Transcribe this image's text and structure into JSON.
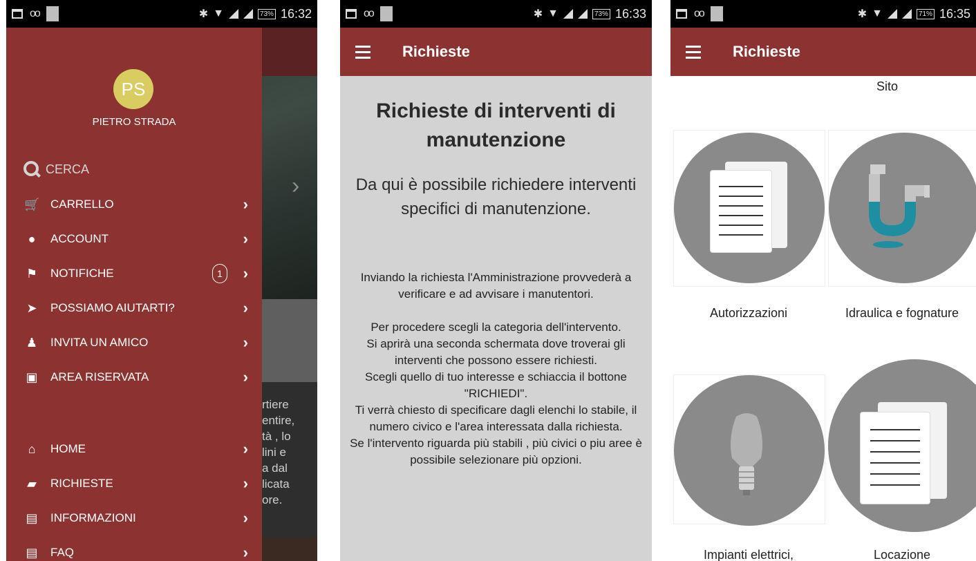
{
  "status_bars": [
    {
      "battery": "73%",
      "time": "16:32"
    },
    {
      "battery": "73%",
      "time": "16:33"
    },
    {
      "battery": "71%",
      "time": "16:35"
    }
  ],
  "drawer": {
    "avatar_initials": "PS",
    "user_name": "PIETRO STRADA",
    "search_label": "CERCA",
    "items": [
      {
        "label": "CARRELLO",
        "icon": "cart-icon"
      },
      {
        "label": "ACCOUNT",
        "icon": "person-icon"
      },
      {
        "label": "NOTIFICHE",
        "icon": "flag-icon",
        "badge": "1"
      },
      {
        "label": "POSSIAMO AIUTARTI?",
        "icon": "paper-plane-icon"
      },
      {
        "label": "INVITA UN AMICO",
        "icon": "people-icon"
      },
      {
        "label": "AREA RISERVATA",
        "icon": "image-box-icon"
      }
    ],
    "bottom_items": [
      {
        "label": "HOME",
        "icon": "home-icon"
      },
      {
        "label": "RICHIESTE",
        "icon": "book-icon"
      },
      {
        "label": "INFORMAZIONI",
        "icon": "document-icon"
      },
      {
        "label": "FAQ",
        "icon": "document-icon"
      }
    ]
  },
  "background_text": [
    "rtiere",
    "entire,",
    "tà , lo",
    "lini e",
    "a dal",
    "licata",
    "ore."
  ],
  "richieste_info": {
    "appbar_title": "Richieste",
    "heading": "Richieste di interventi di manutenzione",
    "subheading": "Da qui è possibile richiedere interventi specifici di manutenzione.",
    "paragraph1": "Inviando la richiesta l'Amministrazione provvederà a verificare e ad avvisare i manutentori.",
    "paragraph2": [
      "Per procedere scegli la categoria dell'intervento.",
      "Si aprirà una seconda schermata dove troverai gli interventi che possono essere richiesti.",
      "Scegli quello di tuo interesse e schiaccia il bottone \"RICHIEDI\".",
      "Ti verrà chiesto di specificare dagli elenchi lo stabile, il numero civico e l'area interessata dalla richiesta.",
      "Se l'intervento riguarda più stabili , più civici o piu aree è possibile selezionare più opzioni."
    ]
  },
  "richieste_categories": {
    "appbar_title": "Richieste",
    "partial_top_label": "Sito",
    "tiles": [
      {
        "label": "Autorizzazioni",
        "icon": "documents-icon"
      },
      {
        "label": "Idraulica e fognature",
        "icon": "pipe-icon"
      },
      {
        "label": "Impianti elettrici,",
        "icon": "lightbulb-icon"
      },
      {
        "label": "Locazione",
        "icon": "documents-icon"
      }
    ]
  },
  "colors": {
    "primary": "#8c3332",
    "avatar": "#d9cc61",
    "info_background": "#d3d3d3",
    "tile_circle": "#8a8a8a"
  }
}
